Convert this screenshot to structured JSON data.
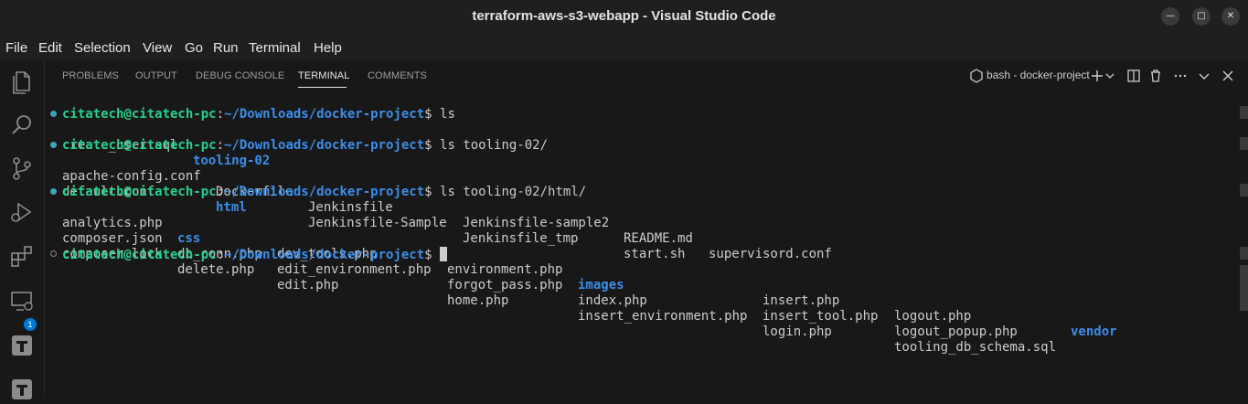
{
  "window": {
    "title": "terraform-aws-s3-webapp - Visual Studio Code"
  },
  "menu": [
    "File",
    "Edit",
    "Selection",
    "View",
    "Go",
    "Run",
    "Terminal",
    "Help"
  ],
  "activity": {
    "extensions_badge": "1"
  },
  "panel": {
    "tabs": [
      "PROBLEMS",
      "OUTPUT",
      "DEBUG CONSOLE",
      "TERMINAL",
      "COMMENTS"
    ],
    "active_tab": "TERMINAL",
    "terminal_label": "bash - docker-project"
  },
  "terminal": {
    "prompt_user": "citatech@citatech-pc",
    "prompt_path": "~/Downloads/docker-project",
    "lines": [
      {
        "cmd": "ls"
      },
      {
        "out": [
          "create_user.sql",
          "tooling-02"
        ]
      },
      {
        "cmd": "ls tooling-02/"
      },
      {
        "out": [
          "apache-config.conf",
          "Dockerfile",
          "Jenkinsfile",
          "Jenkinsfile-sample2",
          "README.md",
          "supervisord.conf"
        ]
      },
      {
        "out": [
          "default.conf",
          "html",
          "Jenkinsfile-Sample",
          "Jenkinsfile_tmp",
          "start.sh"
        ]
      },
      {
        "cmd": "ls tooling-02/html/"
      },
      {
        "out": [
          "analytics.php",
          "css",
          "dev_tools.php",
          "environment.php",
          "images",
          "insert.php",
          "logout.php",
          "vendor"
        ]
      },
      {
        "out": [
          "composer.json",
          "db_conn.php",
          "edit_environment.php",
          "forgot_pass.php",
          "index.php",
          "insert_tool.php",
          "logout_popup.php"
        ]
      },
      {
        "out": [
          "composer.lock",
          "delete.php",
          "edit.php",
          "home.php",
          "insert_environment.php",
          "login.php",
          "tooling_db_schema.sql"
        ]
      },
      {
        "cmd": ""
      }
    ]
  }
}
